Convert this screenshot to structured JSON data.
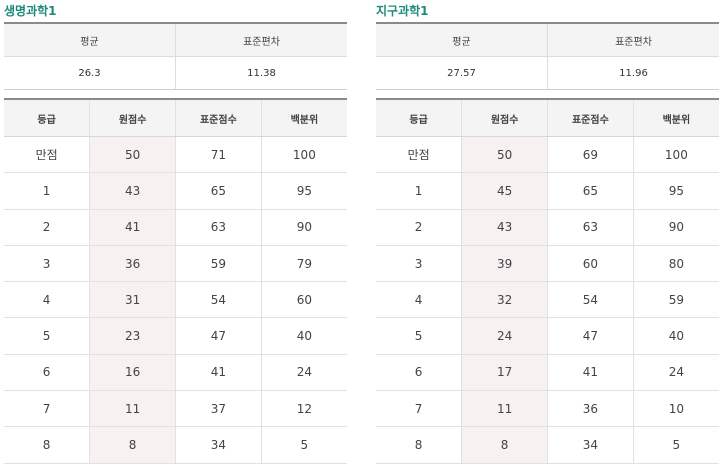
{
  "left": {
    "title": "생명과학1",
    "summary_headers": [
      "평균",
      "표준편차"
    ],
    "summary_values": [
      "26.3",
      "11.38"
    ],
    "grade_headers": [
      "등급",
      "원점수",
      "표준점수",
      "백분위"
    ],
    "rows": [
      [
        "만점",
        "50",
        "71",
        "100"
      ],
      [
        "1",
        "43",
        "65",
        "95"
      ],
      [
        "2",
        "41",
        "63",
        "90"
      ],
      [
        "3",
        "36",
        "59",
        "79"
      ],
      [
        "4",
        "31",
        "54",
        "60"
      ],
      [
        "5",
        "23",
        "47",
        "40"
      ],
      [
        "6",
        "16",
        "41",
        "24"
      ],
      [
        "7",
        "11",
        "37",
        "12"
      ],
      [
        "8",
        "8",
        "34",
        "5"
      ]
    ]
  },
  "right": {
    "title": "지구과학1",
    "summary_headers": [
      "평균",
      "표준편차"
    ],
    "summary_values": [
      "27.57",
      "11.96"
    ],
    "grade_headers": [
      "등급",
      "원점수",
      "표준점수",
      "백분위"
    ],
    "rows": [
      [
        "만점",
        "50",
        "69",
        "100"
      ],
      [
        "1",
        "45",
        "65",
        "95"
      ],
      [
        "2",
        "43",
        "63",
        "90"
      ],
      [
        "3",
        "39",
        "60",
        "80"
      ],
      [
        "4",
        "32",
        "54",
        "59"
      ],
      [
        "5",
        "24",
        "47",
        "40"
      ],
      [
        "6",
        "17",
        "41",
        "24"
      ],
      [
        "7",
        "11",
        "36",
        "10"
      ],
      [
        "8",
        "8",
        "34",
        "5"
      ]
    ]
  },
  "colors": {
    "title": "#1d8a7a",
    "header_bg": "#f4f4f4",
    "raw_score_bg": "#f7f1f2"
  }
}
